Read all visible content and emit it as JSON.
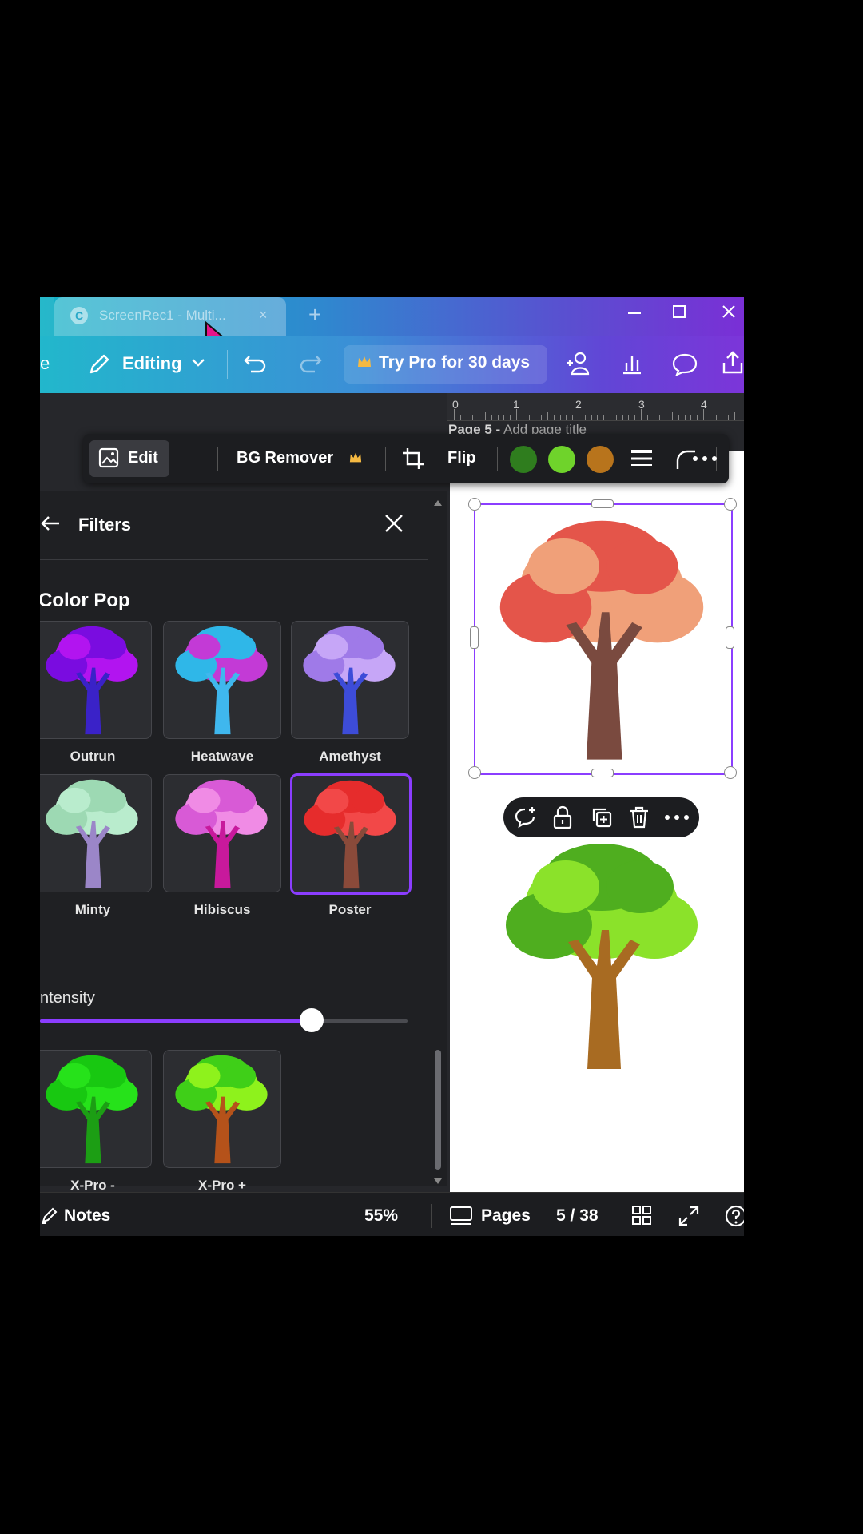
{
  "browser": {
    "tab_title": "ScreenRec1 - Multi...",
    "tab_close": "×",
    "new_tab": "+"
  },
  "toolbar": {
    "file_fragment": "e",
    "editing_label": "Editing",
    "pro_label": "Try Pro for 30 days"
  },
  "ruler": {
    "ticks": [
      "0",
      "1",
      "2",
      "3",
      "4"
    ]
  },
  "page": {
    "label_prefix": "Page 5 -",
    "label_placeholder": "Add page title"
  },
  "editbar": {
    "edit_label": "Edit",
    "bg_remover_label": "BG Remover",
    "flip_label": "Flip",
    "swatches": [
      "#2f7d1e",
      "#6fd32b",
      "#b8741c"
    ]
  },
  "panel": {
    "title": "Filters",
    "section_title": "Color Pop",
    "filters": [
      {
        "label": "Outrun",
        "foliage": "#b214f0",
        "foliage2": "#7a0ce0",
        "trunk": "#3a22c8"
      },
      {
        "label": "Heatwave",
        "foliage": "#c33ad6",
        "foliage2": "#2fb7e8",
        "trunk": "#3fb7ee"
      },
      {
        "label": "Amethyst",
        "foliage": "#c6a6f7",
        "foliage2": "#9f7ae8",
        "trunk": "#3d4cd8"
      },
      {
        "label": "Minty",
        "foliage": "#b9eccd",
        "foliage2": "#9dd9b3",
        "trunk": "#9b86c8"
      },
      {
        "label": "Hibiscus",
        "foliage": "#f08be5",
        "foliage2": "#d85ad6",
        "trunk": "#c8199c"
      },
      {
        "label": "Poster",
        "foliage": "#f24848",
        "foliage2": "#e62c2c",
        "trunk": "#8a4a3a"
      }
    ],
    "selected_filter": "Poster",
    "intensity_label": "ntensity",
    "intensity_value": 0.74,
    "filters_more": [
      {
        "label": "X-Pro -",
        "foliage": "#26e21a",
        "foliage2": "#18c811",
        "trunk": "#1c9e14"
      },
      {
        "label": "X-Pro +",
        "foliage": "#8ef21c",
        "foliage2": "#3fcf18",
        "trunk": "#b5521a"
      }
    ]
  },
  "canvas": {
    "tree_top": {
      "foliage": "#f0a079",
      "foliage2": "#e4554a",
      "trunk": "#7a4a3f"
    },
    "tree_bottom": {
      "foliage": "#8be22a",
      "foliage2": "#4fae1f",
      "trunk": "#a86b22"
    }
  },
  "statusbar": {
    "notes_label": "Notes",
    "zoom": "55%",
    "pages_label": "Pages",
    "page_count": "5 / 38"
  }
}
